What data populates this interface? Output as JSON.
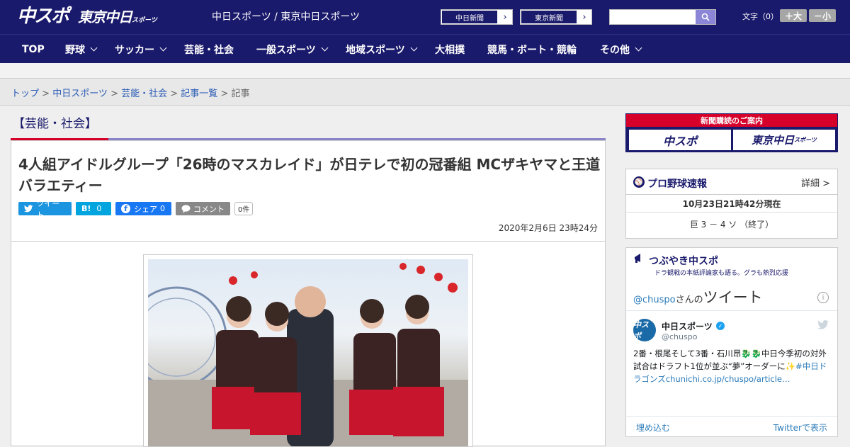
{
  "header": {
    "logo_chuspo": "中スポ",
    "logo_tokyo": "東京中日",
    "logo_tokyo_small": "スポーツ",
    "site_title": "中日スポーツ / 東京中日スポーツ",
    "paper1": "中日新聞",
    "paper2": "東京新聞",
    "font_label": "文字（0）",
    "font_plus": "＋大",
    "font_minus": "－小"
  },
  "nav": [
    {
      "label": "TOP",
      "dropdown": false
    },
    {
      "label": "野球",
      "dropdown": true
    },
    {
      "label": "サッカー",
      "dropdown": true
    },
    {
      "label": "芸能・社会",
      "dropdown": false
    },
    {
      "label": "一般スポーツ",
      "dropdown": true
    },
    {
      "label": "地域スポーツ",
      "dropdown": true
    },
    {
      "label": "大相撲",
      "dropdown": false
    },
    {
      "label": "競馬・ボート・競輪",
      "dropdown": false
    },
    {
      "label": "その他",
      "dropdown": true
    }
  ],
  "breadcrumb": {
    "items": [
      "トップ",
      "中日スポーツ",
      "芸能・社会",
      "記事一覧"
    ],
    "current": "記事",
    "sep": " > "
  },
  "article": {
    "category": "【芸能・社会】",
    "headline": "4人組アイドルグループ「26時のマスカレイド」が日テレで初の冠番組 MCザキヤマと王道バラエティー",
    "share": {
      "tweet": "ツイート",
      "hatena": "B!",
      "hatena_count": "0",
      "facebook": "シェア",
      "facebook_count": "0",
      "comment": "コメント",
      "comment_count": "0件"
    },
    "date": "2020年2月6日 23時24分"
  },
  "sidebar": {
    "subscribe_title": "新聞購読のご案内",
    "subscribe_a": "中スポ",
    "subscribe_b": "東京中日",
    "subscribe_b_small": "スポーツ",
    "baseball": {
      "title": "プロ野球速報",
      "more": "詳細 >",
      "updated": "10月23日21時42分現在",
      "score": "巨 3 － 4 ソ （終了）"
    },
    "tweets": {
      "title": "つぶやき中スポ",
      "subtitle": "ドラ観戦の本紙評論家も語る。グラも熱烈応援",
      "account_prefix": "@chuspo",
      "account_suffix": "さんの",
      "tweet_word": "ツイート",
      "name": "中日スポーツ",
      "handle": "@chuspo",
      "avatar_text": "中スポ",
      "text": "2番・根尾そして3番・石川昂🐉🐉中日今季初の対外試合はドラフト1位が並ぶ“夢”オーダーに✨",
      "hashtag": "#中日ドラゴンズ",
      "link": "chunichi.co.jp/chuspo/article…",
      "embed": "埋め込む",
      "view": "Twitterで表示"
    }
  },
  "colors": {
    "navy": "#1a1a6c",
    "red": "#d6002a",
    "twitter": "#1b95e0",
    "facebook": "#1877f2",
    "link": "#2a5bb5"
  }
}
